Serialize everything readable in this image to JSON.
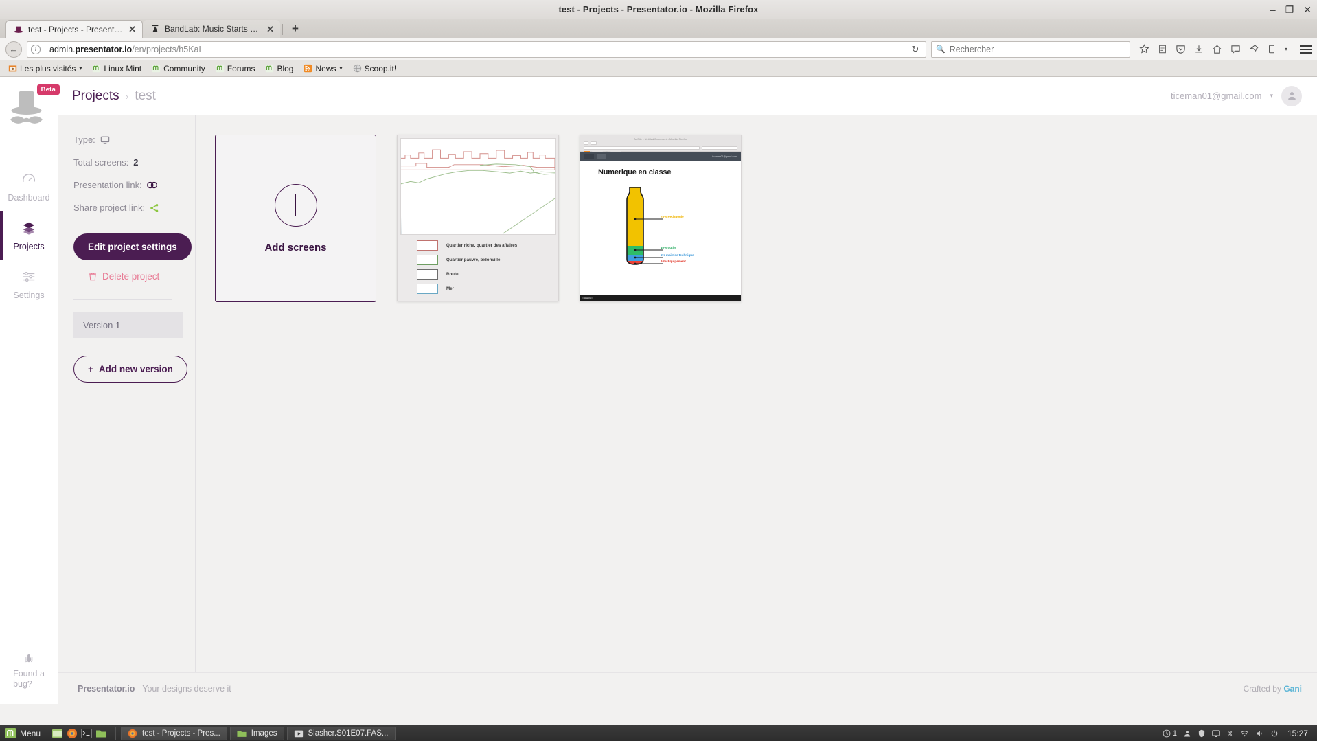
{
  "window": {
    "title": "test - Projects - Presentator.io - Mozilla Firefox",
    "minimize": "–",
    "maximize": "❐",
    "close": "✕"
  },
  "tabs": [
    {
      "label": "test - Projects - Presentat...",
      "close": "✕",
      "favicon": "presentator-hat-icon"
    },
    {
      "label": "BandLab: Music Starts H...",
      "close": "✕",
      "favicon": "bandlab-icon"
    }
  ],
  "new_tab_label": "+",
  "navbar": {
    "back_icon": "←",
    "info_icon": "i",
    "url_prefix": "admin.",
    "url_domain": "presentator.io",
    "url_path": "/en/projects/h5KaL",
    "reload_icon": "↻",
    "search_placeholder": "Rechercher",
    "search_value": "",
    "search_icon": "⚲",
    "icons": [
      "star-icon",
      "reader-icon",
      "pocket-icon",
      "download-icon",
      "home-icon",
      "chat-icon",
      "pin-icon",
      "sync-icon",
      "chevron-down-icon",
      "hamburger-menu-icon"
    ]
  },
  "bookmarks": [
    {
      "label": "Les plus visités",
      "caret": "▾",
      "icon": "most-visited-icon"
    },
    {
      "label": "Linux Mint",
      "caret": "",
      "icon": "mint-icon"
    },
    {
      "label": "Community",
      "caret": "",
      "icon": "mint-icon"
    },
    {
      "label": "Forums",
      "caret": "",
      "icon": "mint-icon"
    },
    {
      "label": "Blog",
      "caret": "",
      "icon": "mint-icon"
    },
    {
      "label": "News",
      "caret": "▾",
      "icon": "rss-icon"
    },
    {
      "label": "Scoop.it!",
      "caret": "",
      "icon": "globe-icon"
    }
  ],
  "sidebar": {
    "beta_badge": "Beta",
    "items": [
      {
        "label": "Dashboard",
        "icon": "gauge-icon",
        "active": false
      },
      {
        "label": "Projects",
        "icon": "layers-icon",
        "active": true
      },
      {
        "label": "Settings",
        "icon": "sliders-icon",
        "active": false
      }
    ],
    "bug": {
      "line1": "Found a",
      "line2": "bug?",
      "icon": "bug-icon"
    }
  },
  "topbar": {
    "breadcrumb_root": "Projects",
    "breadcrumb_sep": "›",
    "breadcrumb_current": "test",
    "user_email": "ticeman01@gmail.com",
    "user_caret": "▾",
    "avatar_icon": "user-avatar-icon"
  },
  "project": {
    "type_label": "Type:",
    "type_icon": "desktop-monitor-icon",
    "total_screens_label": "Total screens:",
    "total_screens_value": "2",
    "presentation_link_label": "Presentation link:",
    "presentation_link_icon": "chain-link-icon",
    "share_link_label": "Share project link:",
    "share_link_icon": "share-icon",
    "edit_button": "Edit project settings",
    "delete_button": "Delete project",
    "delete_icon": "trash-icon",
    "version_label": "Version",
    "version_number": "1",
    "add_version_button": "Add new version",
    "add_version_icon": "+"
  },
  "screens": {
    "add_card": {
      "label": "Add screens",
      "icon": "plus-circle-icon"
    },
    "map_screen": {
      "legend": [
        {
          "label": "Quartier riche, quartier des affaires",
          "color": "#c0736f"
        },
        {
          "label": "Quartier pauvre, bidonville",
          "color": "#6f9e63"
        },
        {
          "label": "Route",
          "color": "#6d6d6d"
        },
        {
          "label": "Mer",
          "color": "#6aa8c4"
        }
      ]
    },
    "bottle_screen": {
      "browser_title": "ArtSite - Untitled Document - Mozilla Firefox",
      "search_placeholder": "Rechercher",
      "nav_right": "ticeman01@gmail.com",
      "heading": "Numerique en classe",
      "annotations": [
        {
          "label": "75% Pedagogie",
          "color": "#f0b400"
        },
        {
          "label": "10% outils",
          "color": "#22a95c"
        },
        {
          "label": "5% maitrise technique",
          "color": "#2a8fd6"
        },
        {
          "label": "10% Equipement",
          "color": "#e23b2e"
        }
      ],
      "footer_badge": "Apercu"
    }
  },
  "footer": {
    "brand": "Presentator.io",
    "tagline": "- Your designs deserve it",
    "credit_prefix": "Crafted by",
    "credit_name": "Gani"
  },
  "taskbar": {
    "menu_label": "Menu",
    "menu_icon": "mint-menu-icon",
    "quick_launch": [
      "terminal-icon",
      "firefox-icon",
      "console-icon",
      "files-icon"
    ],
    "tasks": [
      {
        "label": "test - Projects - Pres...",
        "icon": "firefox-icon",
        "focused": true
      },
      {
        "label": "Images",
        "icon": "folder-icon",
        "focused": false
      },
      {
        "label": "Slasher.S01E07.FAS...",
        "icon": "video-icon",
        "focused": false
      }
    ],
    "tray": [
      {
        "icon": "updates-icon",
        "label": "1"
      },
      {
        "icon": "user-icon",
        "label": ""
      },
      {
        "icon": "shield-icon",
        "label": ""
      },
      {
        "icon": "display-icon",
        "label": ""
      },
      {
        "icon": "bluetooth-icon",
        "label": ""
      },
      {
        "icon": "network-icon",
        "label": ""
      },
      {
        "icon": "volume-icon",
        "label": ""
      },
      {
        "icon": "power-icon",
        "label": ""
      }
    ],
    "clock": "15:27"
  },
  "colors": {
    "accent_purple": "#4b1d52",
    "badge_pink": "#d63a6a",
    "delete_pink": "#e87a94",
    "share_green": "#8cc63f"
  }
}
